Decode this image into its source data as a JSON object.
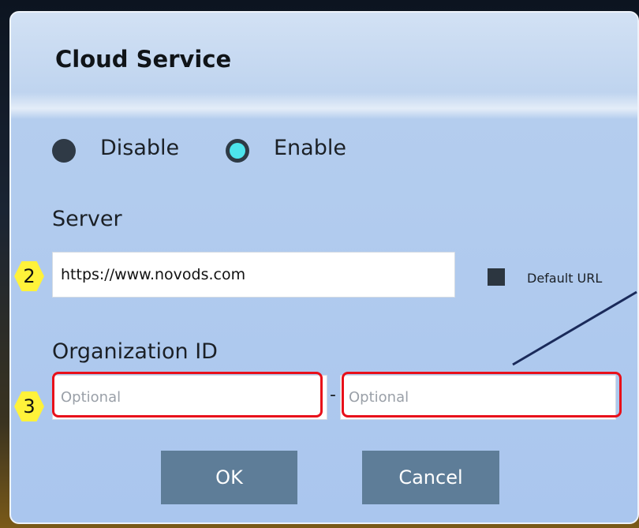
{
  "dialog": {
    "title": "Cloud Service",
    "mode": {
      "options": [
        {
          "label": "Disable",
          "selected": false
        },
        {
          "label": "Enable",
          "selected": true
        }
      ]
    },
    "server": {
      "label": "Server",
      "value": "https://www.novods.com",
      "default_url_label": "Default URL",
      "default_url_checked": true
    },
    "organization": {
      "label": "Organization ID",
      "field1_placeholder": "Optional",
      "field2_placeholder": "Optional",
      "separator": "-"
    },
    "buttons": {
      "ok": "OK",
      "cancel": "Cancel"
    }
  },
  "annotations": {
    "callout_2": "2",
    "callout_3": "3",
    "highlight_color": "#e8101a",
    "callout_color": "#fff23a"
  }
}
